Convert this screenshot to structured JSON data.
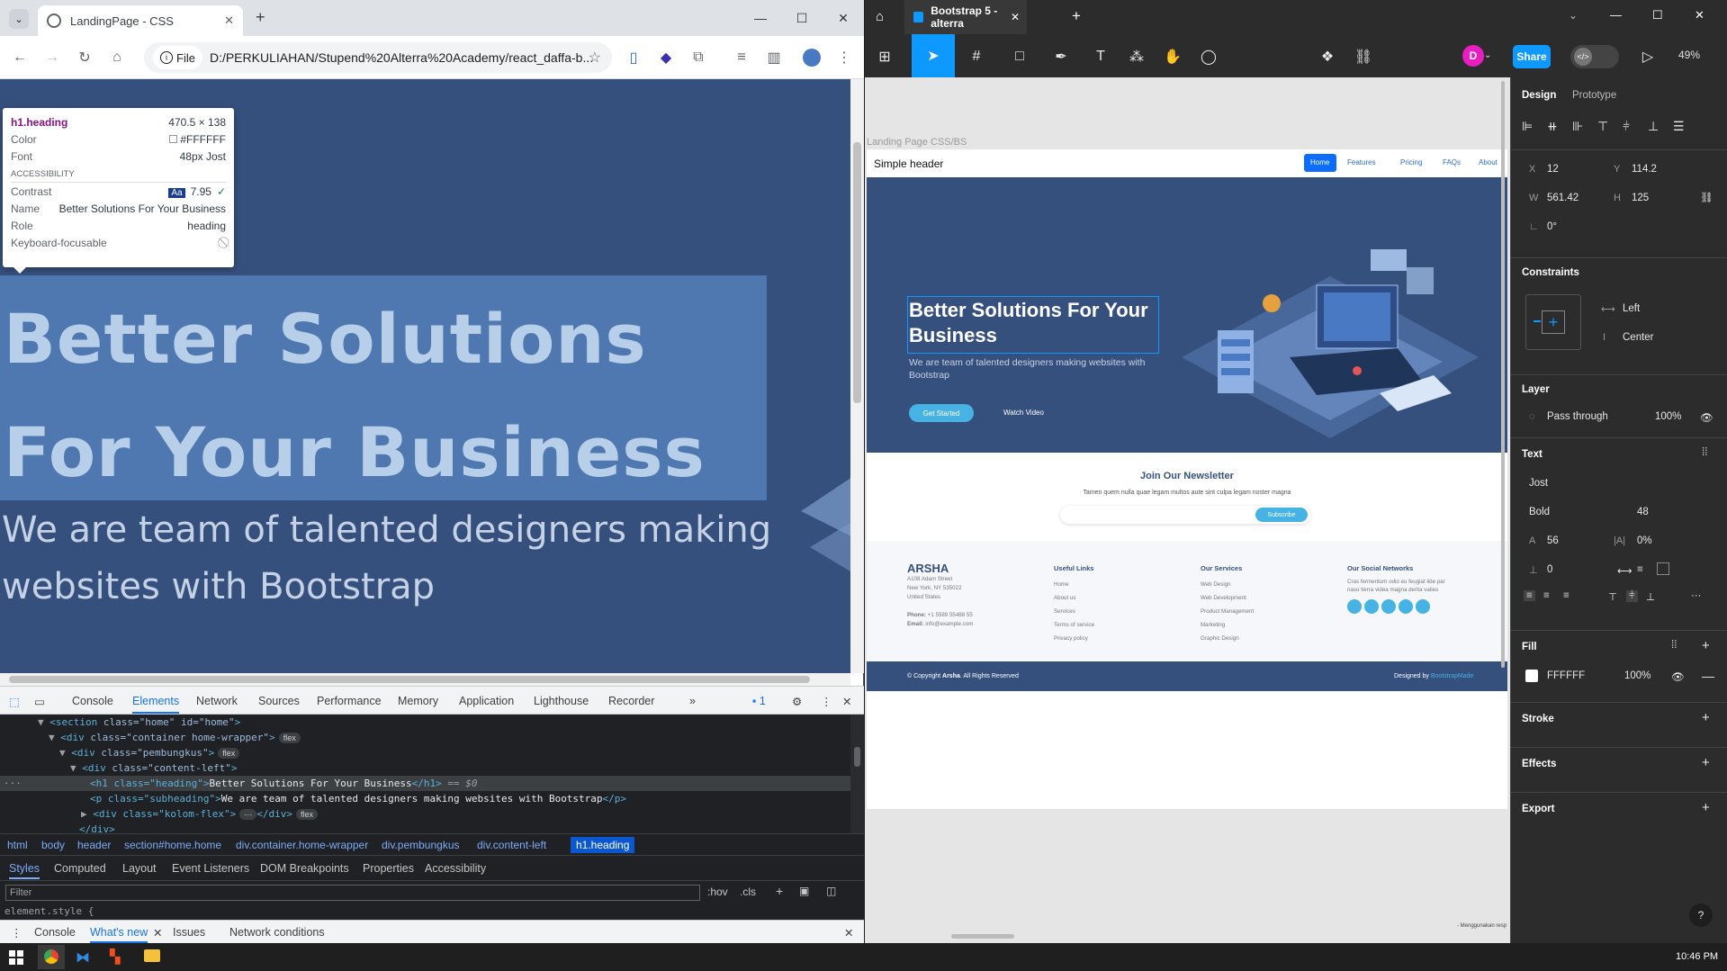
{
  "chrome": {
    "tab_title": "LandingPage - CSS",
    "file_chip": "File",
    "url": "D:/PERKULIAHAN/Stupend%20Alterra%20Academy/react_daffa-b...",
    "tooltip": {
      "selector": "h1.heading",
      "size": "470.5 × 138",
      "color_label": "Color",
      "color_value": "#FFFFFF",
      "font_label": "Font",
      "font_value": "48px Jost",
      "accessibility": "ACCESSIBILITY",
      "contrast_label": "Contrast",
      "contrast_value": "7.95",
      "name_label": "Name",
      "name_value": "Better Solutions For Your Business",
      "role_label": "Role",
      "role_value": "heading",
      "focus_label": "Keyboard-focusable"
    },
    "hero_heading": "Better Solutions For Your Business",
    "hero_subheading": "We are team of talented designers making websites with Bootstrap"
  },
  "devtools": {
    "tabs": [
      "Console",
      "Elements",
      "Network",
      "Sources",
      "Performance",
      "Memory",
      "Application",
      "Lighthouse",
      "Recorder"
    ],
    "issue_count": "1",
    "code_lines": [
      {
        "indent": 0,
        "arrow": "▼",
        "tag": "section",
        "attrs": "class=\"home\" id=\"home\"",
        "pill": ""
      },
      {
        "indent": 1,
        "arrow": "▼",
        "tag": "div",
        "attrs": "class=\"container home-wrapper\"",
        "pill": "flex"
      },
      {
        "indent": 2,
        "arrow": "▼",
        "tag": "div",
        "attrs": "class=\"pembungkus\"",
        "pill": "flex"
      },
      {
        "indent": 3,
        "arrow": "▼",
        "tag": "div",
        "attrs": "class=\"content-left\"",
        "pill": ""
      }
    ],
    "h1_line": {
      "open": "<h1 class=\"heading\">",
      "text": "Better Solutions For Your Business",
      "close": "</h1>",
      "eq": " == $0"
    },
    "p_line": {
      "open": "<p class=\"subheading\">",
      "text": "We are team of talented designers making websites with Bootstrap",
      "close": "</p>"
    },
    "kolom_line": "<div class=\"kolom-flex\">",
    "kolom_close": "</div>",
    "last_line": "</div>",
    "breadcrumbs": [
      "html",
      "body",
      "header",
      "section#home.home",
      "div.container.home-wrapper",
      "div.pembungkus",
      "div.content-left",
      "h1.heading"
    ],
    "subtabs": [
      "Styles",
      "Computed",
      "Layout",
      "Event Listeners",
      "DOM Breakpoints",
      "Properties",
      "Accessibility"
    ],
    "filter_placeholder": "Filter",
    "hov": ":hov",
    "cls": ".cls",
    "element_style": "element.style {",
    "drawer_tabs": [
      "Console",
      "What's new",
      "Issues",
      "Network conditions"
    ]
  },
  "figma": {
    "tab_title": "Bootstrap 5 - alterra",
    "user_initial": "D",
    "share_label": "Share",
    "zoom": "49%",
    "frame_label": "Landing Page CSS/BS",
    "landing": {
      "brand": "Simple header",
      "nav": [
        "Home",
        "Features",
        "Pricing",
        "FAQs",
        "About"
      ],
      "heading": "Better Solutions For Your Business",
      "subheading": "We are team of talented designers making websites with Bootstrap",
      "cta": "Get Started",
      "watch": "Watch Video",
      "news_title": "Join Our Newsletter",
      "news_text": "Tamen quem nulla quae legam multos aute sint culpa legam noster magna",
      "subscribe": "Subscribe",
      "footer_brand": "ARSHA",
      "address": [
        "A108 Adam Street",
        "New York, NY 535022",
        "United States"
      ],
      "phone_label": "Phone:",
      "phone": "+1 5589 55488 55",
      "email_label": "Email:",
      "email": "info@example.com",
      "useful_title": "Useful Links",
      "useful": [
        "Home",
        "About us",
        "Services",
        "Terms of service",
        "Privacy policy"
      ],
      "services_title": "Our Services",
      "services": [
        "Web Design",
        "Web Development",
        "Product Management",
        "Marketing",
        "Graphic Design"
      ],
      "social_title": "Our Social Networks",
      "social_text": "Cras fermentum odio eu feugiat lide par naso tierra videa magna derita valies",
      "copyright_pre": "© Copyright",
      "copyright_brand": "Arsha",
      "copyright_post": ". All Rights Reserved",
      "designed_pre": "Designed by",
      "designed_by": "BootstrapMade"
    },
    "footnote": "- Menggunakan resp",
    "panel": {
      "tab_design": "Design",
      "tab_prototype": "Prototype",
      "x_label": "X",
      "x": "12",
      "y_label": "Y",
      "y": "114.2",
      "w_label": "W",
      "w": "561.42",
      "h_label": "H",
      "h": "125",
      "rot_label": "∟",
      "rotation": "0°",
      "constraints": "Constraints",
      "c_horizontal": "Left",
      "c_vertical": "Center",
      "layer": "Layer",
      "blend": "Pass through",
      "layer_opacity": "100%",
      "text": "Text",
      "font_family": "Jost",
      "font_weight": "Bold",
      "font_size": "48",
      "line_height": "56",
      "letter_spacing": "0%",
      "para_spacing": "0",
      "fill": "Fill",
      "fill_hex": "FFFFFF",
      "fill_opacity": "100%",
      "stroke": "Stroke",
      "effects": "Effects",
      "export": "Export"
    }
  },
  "taskbar": {
    "time": "10:46 PM"
  },
  "colors": {
    "hero_blue": "#36507e",
    "accent": "#47b2e4",
    "figma_blue": "#0d99ff"
  }
}
